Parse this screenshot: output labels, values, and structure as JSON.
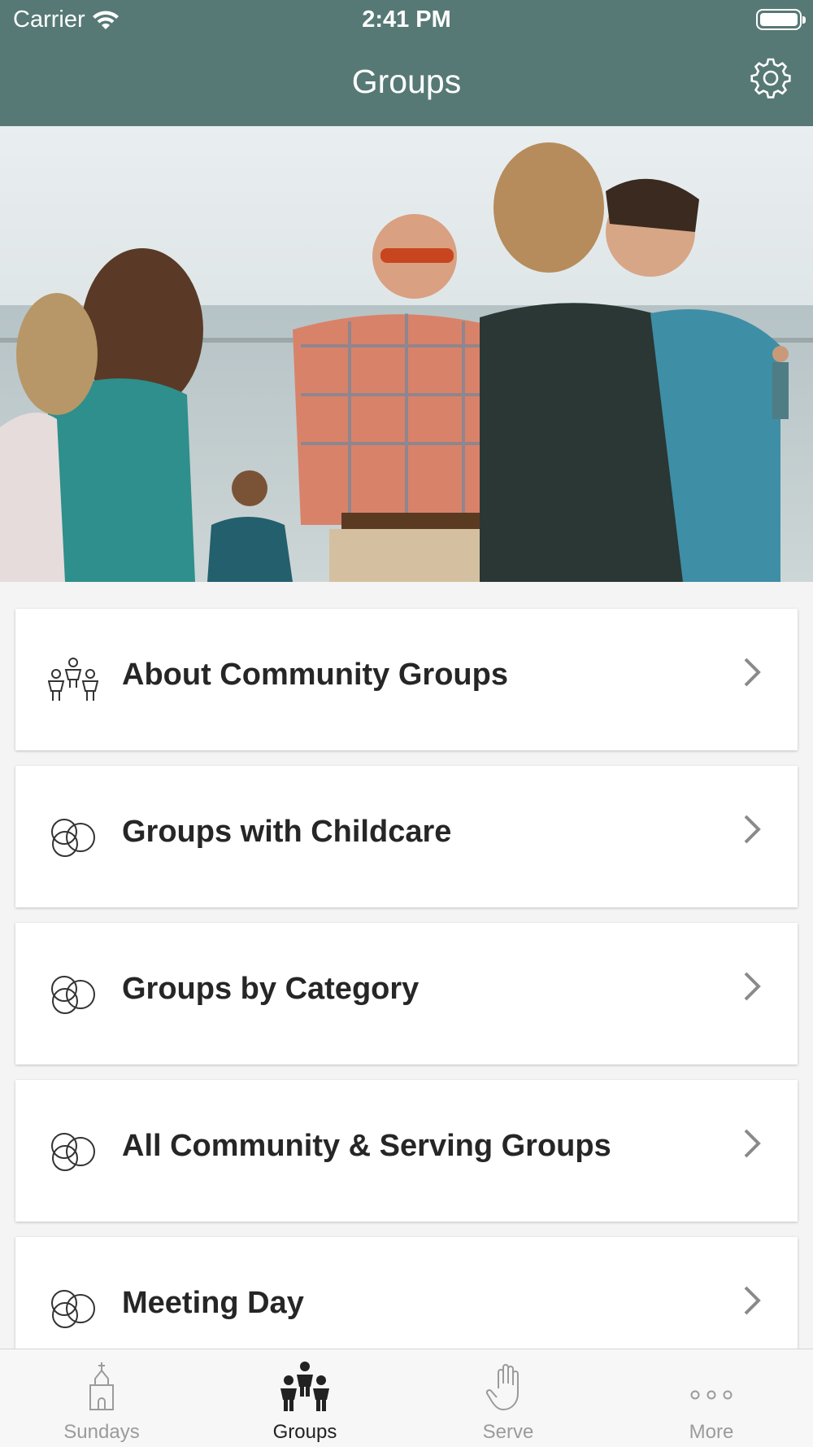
{
  "status_bar": {
    "carrier": "Carrier",
    "time": "2:41 PM"
  },
  "header": {
    "title": "Groups"
  },
  "hero_image": {
    "icon": "group-photo-beach"
  },
  "menu_items": [
    {
      "label": "About Community Groups",
      "icon": "people-icon"
    },
    {
      "label": "Groups with Childcare",
      "icon": "circles-icon"
    },
    {
      "label": "Groups by Category",
      "icon": "circles-icon"
    },
    {
      "label": "All Community & Serving Groups",
      "icon": "circles-icon"
    },
    {
      "label": "Meeting Day",
      "icon": "circles-icon"
    }
  ],
  "tab_bar": {
    "tabs": [
      {
        "label": "Sundays",
        "icon": "church-icon",
        "active": false
      },
      {
        "label": "Groups",
        "icon": "people-icon",
        "active": true
      },
      {
        "label": "Serve",
        "icon": "hand-icon",
        "active": false
      },
      {
        "label": "More",
        "icon": "more-icon",
        "active": false
      }
    ]
  },
  "colors": {
    "header": "#567975",
    "active_tab": "#222222",
    "inactive_tab": "#9b9b9b"
  }
}
